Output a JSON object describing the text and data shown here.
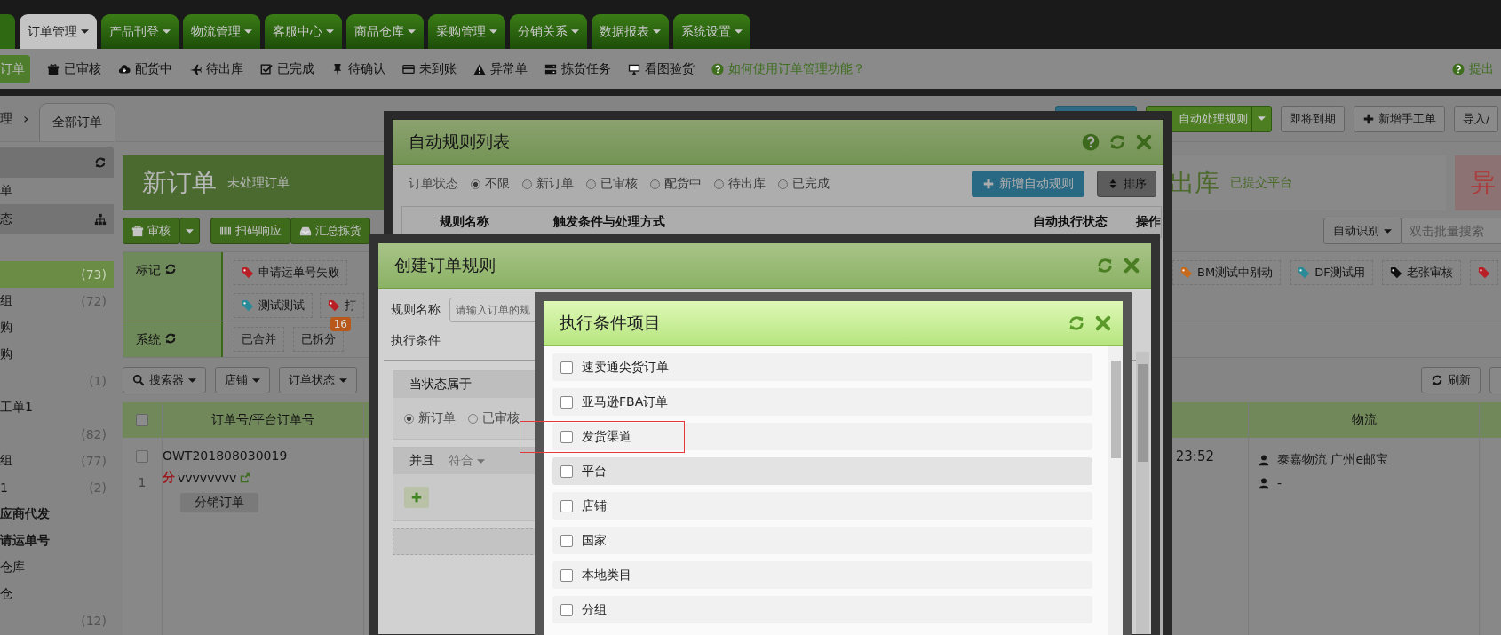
{
  "top_tabs": [
    {
      "label": "订单管理",
      "selected": true
    },
    {
      "label": "产品刊登",
      "selected": false
    },
    {
      "label": "物流管理",
      "selected": false
    },
    {
      "label": "客服中心",
      "selected": false
    },
    {
      "label": "商品仓库",
      "selected": false
    },
    {
      "label": "采购管理",
      "selected": false
    },
    {
      "label": "分销关系",
      "selected": false
    },
    {
      "label": "数据报表",
      "selected": false
    },
    {
      "label": "系统设置",
      "selected": false
    }
  ],
  "sub_nav": {
    "cut_button": "订单",
    "items": [
      "已审核",
      "配货中",
      "待出库",
      "已完成",
      "待确认",
      "未到账",
      "异常单",
      "拣货任务",
      "看图验货"
    ],
    "help_link": "如何使用订单管理功能？",
    "feedback_link": "提出"
  },
  "breadcrumb": {
    "crumb": "理",
    "separator": "›",
    "tab": "全部订单"
  },
  "action_buttons": [
    {
      "kind": "sync"
    },
    {
      "kind": "split",
      "label": "自动处理规则"
    },
    {
      "kind": "plain",
      "label": "即将到期"
    },
    {
      "kind": "plus",
      "label": "新增手工单"
    },
    {
      "kind": "plain",
      "label": "导入/"
    }
  ],
  "sidebar": {
    "items": [
      {
        "kind": "item",
        "label": "单",
        "selected": false,
        "bold": false
      },
      {
        "kind": "header",
        "label": "态",
        "selected": false,
        "bold": false
      },
      {
        "kind": "item",
        "count": "(73)",
        "selected": true,
        "bold": false
      },
      {
        "kind": "item",
        "label": "组",
        "count": "(72)",
        "selected": false,
        "bold": false
      },
      {
        "kind": "item",
        "label": "购",
        "selected": false,
        "bold": false
      },
      {
        "kind": "item",
        "label": "购",
        "selected": false,
        "bold": false
      },
      {
        "kind": "item",
        "count": "(1)",
        "selected": false,
        "bold": false
      },
      {
        "kind": "item",
        "label": "工单1",
        "selected": false,
        "bold": false
      },
      {
        "kind": "item",
        "count": "(82)",
        "selected": false,
        "bold": false
      },
      {
        "kind": "item",
        "label": "组",
        "count": "(77)",
        "selected": false,
        "bold": false
      },
      {
        "kind": "item",
        "label": "1",
        "count": "(2)",
        "selected": false,
        "bold": false
      },
      {
        "kind": "item",
        "label": "应商代发",
        "selected": false,
        "bold": true
      },
      {
        "kind": "item",
        "label": "请运单号",
        "selected": false,
        "bold": true
      },
      {
        "kind": "item",
        "label": "仓库",
        "selected": false,
        "bold": false
      },
      {
        "kind": "item",
        "label": "仓",
        "selected": false,
        "bold": false
      },
      {
        "kind": "item",
        "count": "(12)",
        "selected": false,
        "bold": false
      }
    ]
  },
  "stats": [
    {
      "kind": "green",
      "title": "新订单",
      "subtitle": "未处理订单"
    },
    {
      "kind": "plain",
      "title": "出库",
      "subtitle": "已提交平台"
    },
    {
      "kind": "red",
      "title": "异"
    }
  ],
  "toolbar": {
    "review_button": "审核",
    "scan_button": "扫码响应",
    "pick_button": "汇总拣货",
    "search_mode": "自动识别",
    "search": {
      "placeholder": "双击批量搜索"
    }
  },
  "filters": {
    "mark_label": "标记",
    "system_label": "系统",
    "mark_rows": [
      {
        "left": [
          {
            "label": "申请运单号失败",
            "color": "#b82025"
          }
        ],
        "right": [
          {
            "label": "BM测试中别动",
            "color": "#c86a1c"
          },
          {
            "label": "DF测试用",
            "color": "#2a8a98"
          },
          {
            "label": "老张审核",
            "color": "#111111"
          },
          {
            "color": "#b82025"
          }
        ]
      },
      {
        "left": [
          {
            "label": "测试测试",
            "color": "#2a8a98"
          },
          {
            "label": "打",
            "color": "#b82025"
          }
        ],
        "right": []
      }
    ],
    "system_tags": [
      {
        "label": "已合并"
      },
      {
        "label": "已拆分",
        "badge": "16"
      }
    ]
  },
  "search_row": {
    "buttons": [
      "搜索器",
      "店铺",
      "订单状态"
    ],
    "refresh_button": "刷新"
  },
  "table": {
    "header_checked": false,
    "columns": [
      {
        "label": "订单号/平台订单号"
      },
      {
        "label": "物流"
      }
    ],
    "rows": [
      {
        "index": "1",
        "checked": false,
        "order_no": "OWT201808030019",
        "flag": "分",
        "buyer": "vvvvvvvv",
        "tag": "分销订单",
        "time": "23:52",
        "logistics": [
          "泰嘉物流 广州e邮宝",
          "-"
        ]
      }
    ]
  },
  "rule_list_dialog": {
    "title": "自动规则列表",
    "status_label": "订单状态",
    "statuses": [
      {
        "label": "不限",
        "selected": true
      },
      {
        "label": "新订单",
        "selected": false
      },
      {
        "label": "已审核",
        "selected": false
      },
      {
        "label": "配货中",
        "selected": false
      },
      {
        "label": "待出库",
        "selected": false
      },
      {
        "label": "已完成",
        "selected": false
      }
    ],
    "add_button": "新增自动规则",
    "sort_button": "排序",
    "columns": [
      "规则名称",
      "触发条件与处理方式",
      "自动执行状态",
      "操作"
    ]
  },
  "create_rule_dialog": {
    "title": "创建订单规则",
    "name_label": "规则名称",
    "name_field": {
      "placeholder": "请输入订单的规"
    },
    "conditions_label": "执行条件",
    "state_panel": {
      "title": "当状态属于",
      "options": [
        {
          "label": "新订单",
          "selected": true
        },
        {
          "label": "已审核",
          "selected": false
        }
      ]
    },
    "logic": {
      "label": "并且",
      "mode": "符合"
    }
  },
  "condition_items_dialog": {
    "title": "执行条件项目",
    "items": [
      {
        "label": "速卖通尖货订单",
        "checked": false,
        "hovered": false,
        "highlighted": false
      },
      {
        "label": "亚马逊FBA订单",
        "checked": false,
        "hovered": false,
        "highlighted": false
      },
      {
        "label": "发货渠道",
        "checked": false,
        "hovered": false,
        "highlighted": true
      },
      {
        "label": "平台",
        "checked": false,
        "hovered": true,
        "highlighted": false
      },
      {
        "label": "店铺",
        "checked": false,
        "hovered": false,
        "highlighted": false
      },
      {
        "label": "国家",
        "checked": false,
        "hovered": false,
        "highlighted": false
      },
      {
        "label": "本地类目",
        "checked": false,
        "hovered": false,
        "highlighted": false
      },
      {
        "label": "分组",
        "checked": false,
        "hovered": false,
        "highlighted": false
      }
    ]
  }
}
